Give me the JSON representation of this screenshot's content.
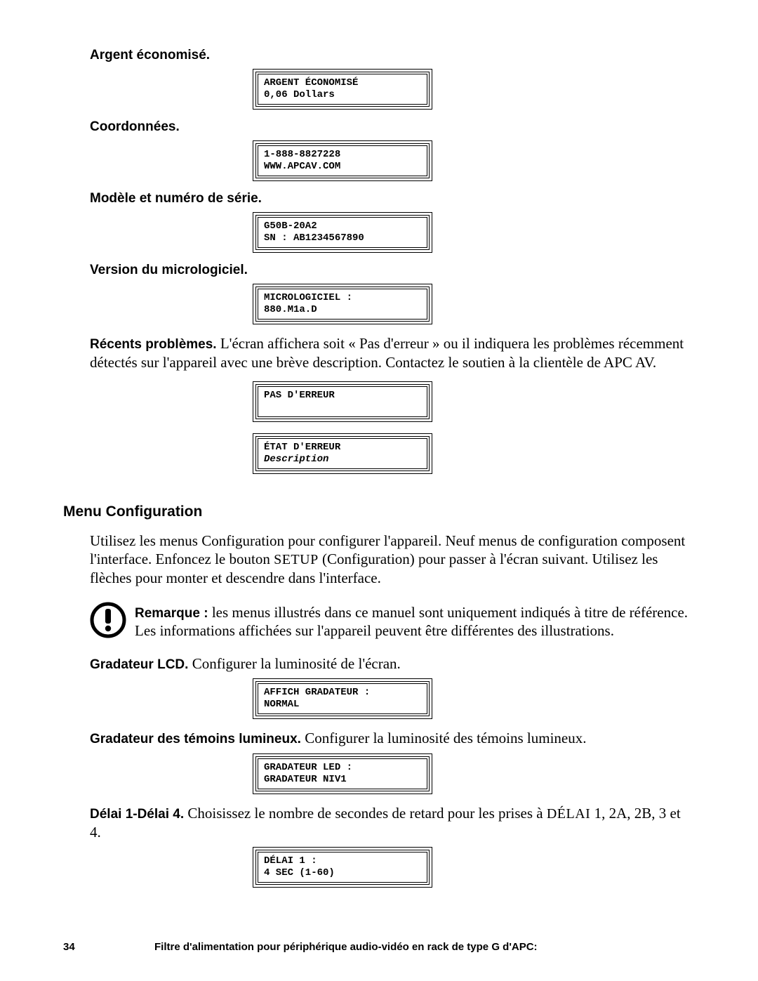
{
  "sections": {
    "money": {
      "label": "Argent économisé.",
      "lcd_line1": "ARGENT ÉCONOMISÉ",
      "lcd_line2": "0,06 Dollars"
    },
    "contact": {
      "label": "Coordonnées.",
      "lcd_line1": "1-888-8827228",
      "lcd_line2": "WWW.APCAV.COM"
    },
    "model": {
      "label": "Modèle et numéro de série.",
      "lcd_line1": "G50B-20A2",
      "lcd_line2": "SN : AB1234567890"
    },
    "firmware": {
      "label": "Version du micrologiciel.",
      "lcd_line1": "MICROLOGICIEL :",
      "lcd_line2": "880.M1a.D"
    },
    "recent": {
      "runin": "Récents problèmes. ",
      "text": "L'écran affichera soit « Pas d'erreur » ou il indiquera les problèmes récemment détectés sur l'appareil avec une brève description. Contactez le soutien à la clientèle de APC AV.",
      "lcd1_line1": "PAS D'ERREUR",
      "lcd1_line2": "",
      "lcd2_line1": "ÉTAT D'ERREUR",
      "lcd2_line2": "Description"
    }
  },
  "menu": {
    "title": "Menu Configuration",
    "para": "Utilisez les menus Configuration pour configurer l'appareil. Neuf menus de configuration composent l'interface. Enfoncez le bouton ",
    "setup_word": "SETUP",
    "para2": " (Configuration) pour passer à l'écran suivant. Utilisez les flèches pour monter et descendre dans l'interface.",
    "note_runin": "Remarque : ",
    "note_text": "les menus illustrés dans ce manuel sont uniquement indiqués à titre de référence. Les informations affichées sur l'appareil peuvent être différentes des illustrations.",
    "lcd_dimmer": {
      "runin": "Gradateur LCD. ",
      "text": "Configurer la luminosité de l'écran.",
      "lcd_line1": "AFFICH GRADATEUR :",
      "lcd_line2": "NORMAL"
    },
    "led_dimmer": {
      "runin": "Gradateur des témoins lumineux. ",
      "text": "Configurer la luminosité des témoins lumineux.",
      "lcd_line1": "GRADATEUR LED :",
      "lcd_line2": "GRADATEUR NIV1"
    },
    "delay": {
      "runin": "Délai 1-Délai 4. ",
      "text_pre": "Choisissez le nombre de secondes de retard pour les prises à ",
      "delai_word": "DÉLAI",
      "text_post": " 1, 2A, 2B, 3 et 4.",
      "lcd_line1": "DÉLAI 1 :",
      "lcd_line2": "4 SEC (1-60)"
    }
  },
  "footer": {
    "page_num": "34",
    "text": "Filtre d'alimentation pour périphérique audio-vidéo en rack de type G d'APC:"
  }
}
